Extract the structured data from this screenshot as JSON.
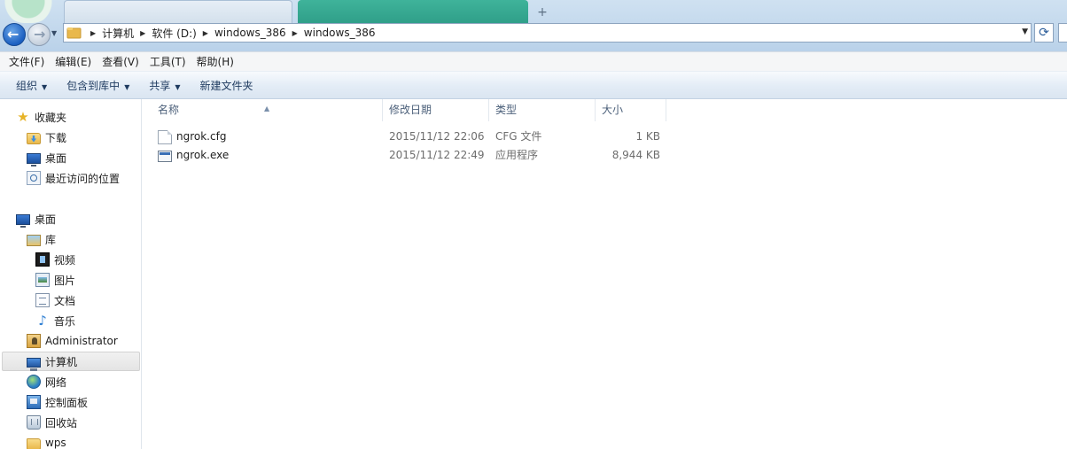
{
  "address_bar": {
    "breadcrumbs": [
      "计算机",
      "软件 (D:)",
      "windows_386",
      "windows_386"
    ]
  },
  "menubar": {
    "items": [
      "文件(F)",
      "编辑(E)",
      "查看(V)",
      "工具(T)",
      "帮助(H)"
    ]
  },
  "toolbar": {
    "organize": "组织",
    "include_library": "包含到库中",
    "share": "共享",
    "new_folder": "新建文件夹"
  },
  "nav": {
    "favorites": "收藏夹",
    "downloads": "下载",
    "desktop_fav": "桌面",
    "recent": "最近访问的位置",
    "desktop": "桌面",
    "libraries": "库",
    "videos": "视频",
    "pictures": "图片",
    "documents": "文档",
    "music": "音乐",
    "administrator": "Administrator",
    "computer": "计算机",
    "network": "网络",
    "control_panel": "控制面板",
    "recycle_bin": "回收站",
    "wps": "wps"
  },
  "columns": {
    "name": "名称",
    "modified": "修改日期",
    "type": "类型",
    "size": "大小"
  },
  "files": [
    {
      "name": "ngrok.cfg",
      "modified": "2015/11/12 22:06",
      "type": "CFG 文件",
      "size": "1 KB",
      "icon": "cfg-file-icon"
    },
    {
      "name": "ngrok.exe",
      "modified": "2015/11/12 22:49",
      "type": "应用程序",
      "size": "8,944 KB",
      "icon": "exe-file-icon"
    }
  ],
  "colors": {
    "accent": "#1b5fc1",
    "chrome_bg": "#cfe1f1",
    "selected_tab": "#2f9e88"
  }
}
